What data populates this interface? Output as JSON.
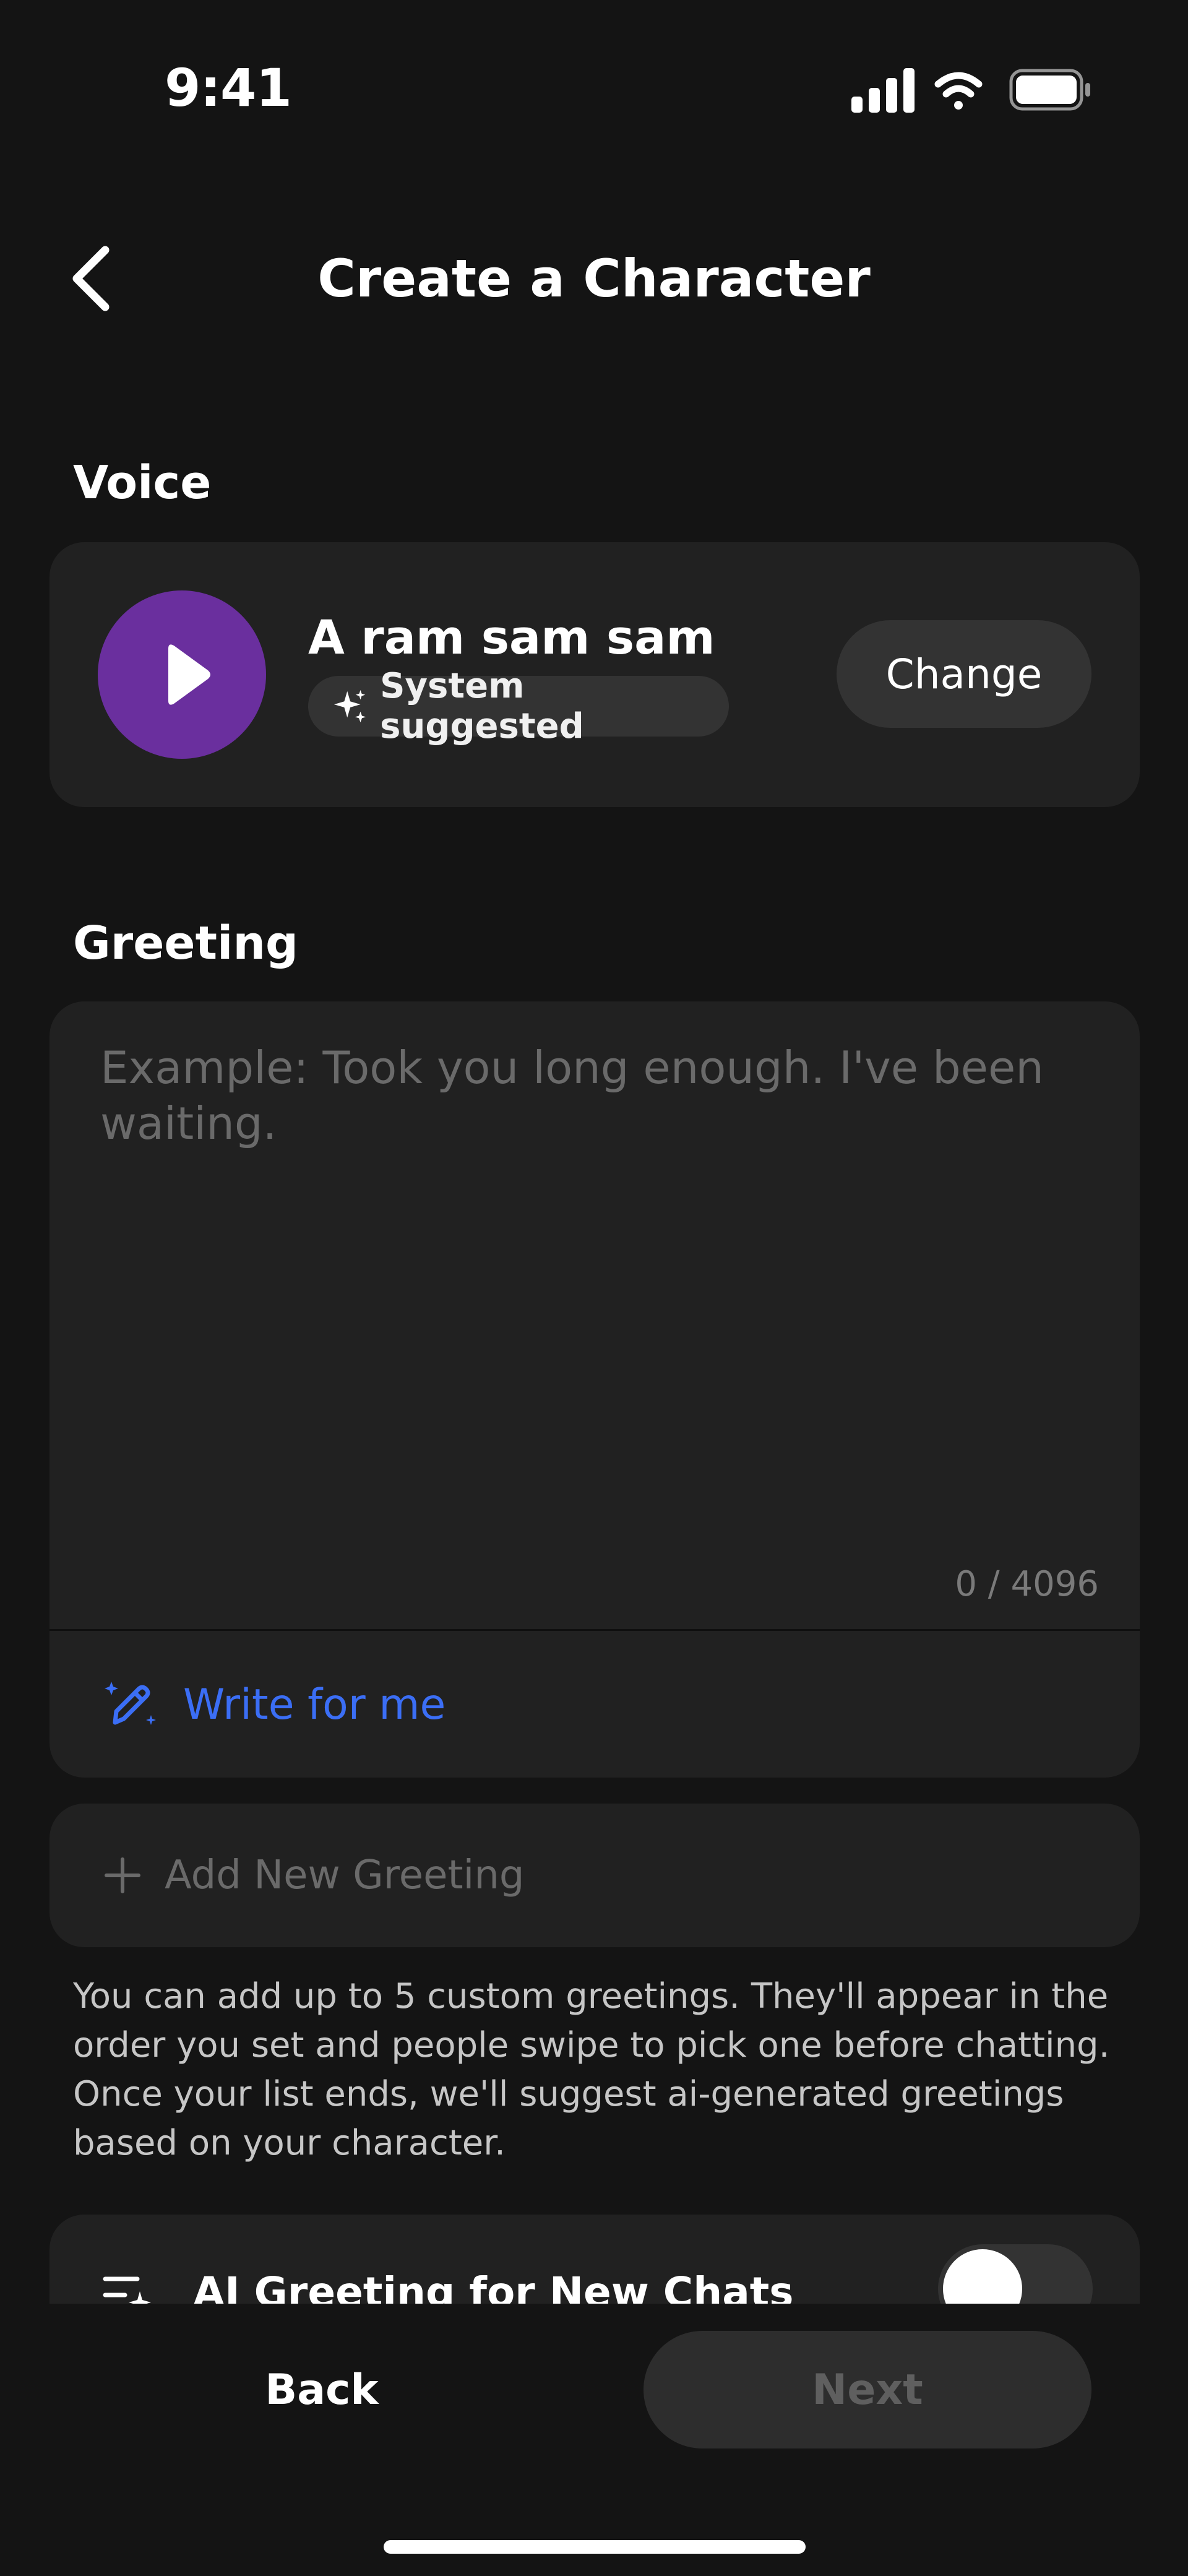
{
  "status_bar": {
    "time": "9:41",
    "icons": [
      "cellular-signal-icon",
      "wifi-icon",
      "battery-icon"
    ]
  },
  "header": {
    "title": "Create a Character",
    "back_icon": "chevron-left-icon"
  },
  "voice": {
    "section_label": "Voice",
    "name": "A ram sam sam",
    "badge": "System suggested",
    "badge_icon": "sparkle-icon",
    "play_icon": "play-icon",
    "change_label": "Change",
    "accent_color": "#6a2f9e"
  },
  "greeting": {
    "section_label": "Greeting",
    "value": "",
    "placeholder": "Example: Took you long enough. I've been waiting.",
    "char_count": "0 / 4096",
    "write_for_me_label": "Write for me",
    "write_icon": "magic-pen-icon",
    "link_color": "#3b6ef5"
  },
  "add_greeting": {
    "label": "Add New Greeting",
    "icon": "plus-icon"
  },
  "helper_text": "You can add up to 5 custom greetings. They'll appear in the order you set and people swipe to pick one before chatting. Once your list ends, we'll suggest ai-generated greetings based on your character.",
  "ai_greeting": {
    "label": "AI Greeting for New Chats",
    "icon": "ai-list-icon",
    "toggle_on": false
  },
  "footer": {
    "back_label": "Back",
    "next_label": "Next"
  }
}
